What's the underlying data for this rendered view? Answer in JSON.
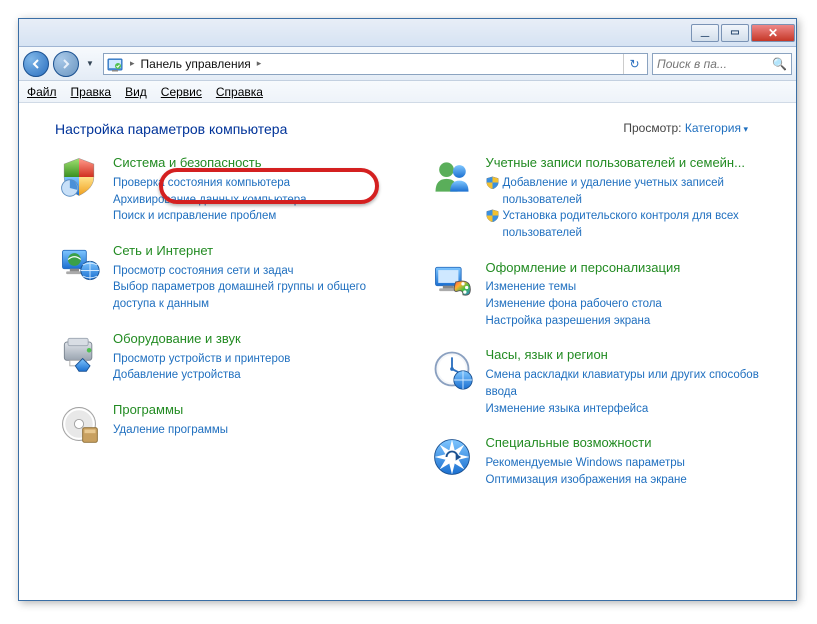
{
  "window": {
    "breadcrumb_root": "Панель управления"
  },
  "search": {
    "placeholder": "Поиск в па..."
  },
  "menu": {
    "file": "Файл",
    "edit": "Правка",
    "view": "Вид",
    "tools": "Сервис",
    "help": "Справка"
  },
  "page": {
    "title": "Настройка параметров компьютера",
    "view_label": "Просмотр:",
    "view_value": "Категория"
  },
  "left": [
    {
      "icon": "security",
      "title": "Система и безопасность",
      "subs": [
        {
          "shield": false,
          "text": "Проверка состояния компьютера"
        },
        {
          "shield": false,
          "text": "Архивирование данных компьютера"
        },
        {
          "shield": false,
          "text": "Поиск и исправление проблем"
        }
      ]
    },
    {
      "icon": "network",
      "title": "Сеть и Интернет",
      "subs": [
        {
          "shield": false,
          "text": "Просмотр состояния сети и задач"
        },
        {
          "shield": false,
          "text": "Выбор параметров домашней группы и общего доступа к данным"
        }
      ]
    },
    {
      "icon": "hardware",
      "title": "Оборудование и звук",
      "subs": [
        {
          "shield": false,
          "text": "Просмотр устройств и принтеров"
        },
        {
          "shield": false,
          "text": "Добавление устройства"
        }
      ]
    },
    {
      "icon": "programs",
      "title": "Программы",
      "subs": [
        {
          "shield": false,
          "text": "Удаление программы"
        }
      ]
    }
  ],
  "right": [
    {
      "icon": "users",
      "title": "Учетные записи пользователей и семейн...",
      "subs": [
        {
          "shield": true,
          "text": "Добавление и удаление учетных записей пользователей"
        },
        {
          "shield": true,
          "text": "Установка родительского контроля для всех пользователей"
        }
      ]
    },
    {
      "icon": "appearance",
      "title": "Оформление и персонализация",
      "subs": [
        {
          "shield": false,
          "text": "Изменение темы"
        },
        {
          "shield": false,
          "text": "Изменение фона рабочего стола"
        },
        {
          "shield": false,
          "text": "Настройка разрешения экрана"
        }
      ]
    },
    {
      "icon": "clock",
      "title": "Часы, язык и регион",
      "subs": [
        {
          "shield": false,
          "text": "Смена раскладки клавиатуры или других способов ввода"
        },
        {
          "shield": false,
          "text": "Изменение языка интерфейса"
        }
      ]
    },
    {
      "icon": "ease",
      "title": "Специальные возможности",
      "subs": [
        {
          "shield": false,
          "text": "Рекомендуемые Windows параметры"
        },
        {
          "shield": false,
          "text": "Оптимизация изображения на экране"
        }
      ]
    }
  ]
}
